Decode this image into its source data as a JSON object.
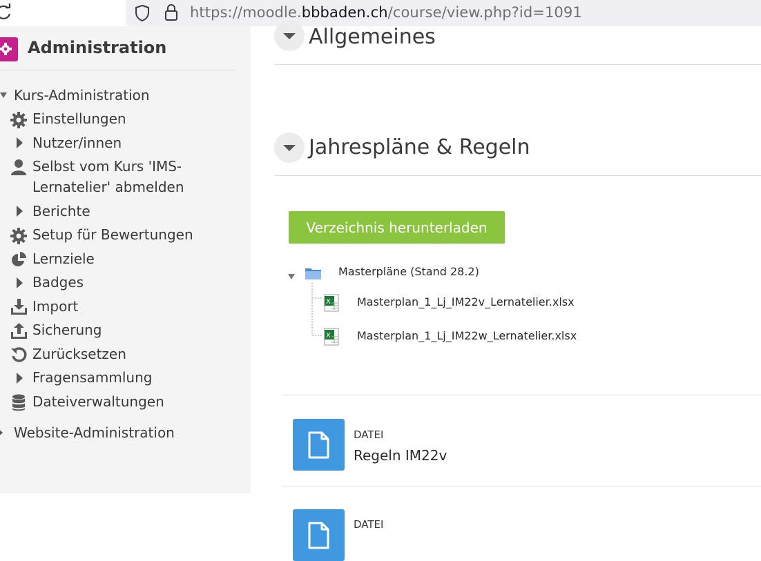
{
  "browser": {
    "url_prefix": "https://moodle.",
    "url_domain": "bbbaden.ch",
    "url_path": "/course/view.php?id=1091"
  },
  "sidebar": {
    "title": "Administration",
    "items": [
      {
        "label": "Kurs-Administration"
      },
      {
        "label": "Einstellungen"
      },
      {
        "label": "Nutzer/innen"
      },
      {
        "label": "Selbst vom Kurs 'IMS-"
      },
      {
        "label": "Lernatelier' abmelden"
      },
      {
        "label": "Berichte"
      },
      {
        "label": "Setup für Bewertungen"
      },
      {
        "label": "Lernziele"
      },
      {
        "label": "Badges"
      },
      {
        "label": "Import"
      },
      {
        "label": "Sicherung"
      },
      {
        "label": "Zurücksetzen"
      },
      {
        "label": "Fragensammlung"
      },
      {
        "label": "Dateiverwaltungen"
      },
      {
        "label": "Website-Administration"
      }
    ]
  },
  "main": {
    "section1_title": "Allgemeines",
    "section2_title": "Jahrespläne & Regeln",
    "download_button": "Verzeichnis herunterladen",
    "folder_name": "Masterpläne (Stand 28.2)",
    "files": [
      "Masterplan_1_Lj_IM22v_Lernatelier.xlsx",
      "Masterplan_1_Lj_IM22w_Lernatelier.xlsx"
    ],
    "resources": [
      {
        "type": "DATEI",
        "name": "Regeln IM22v"
      },
      {
        "type": "DATEI",
        "name": ""
      }
    ]
  },
  "colors": {
    "admin_icon": "#c4218c",
    "download_button": "#8bc43f",
    "resource_icon": "#3f98e0"
  }
}
